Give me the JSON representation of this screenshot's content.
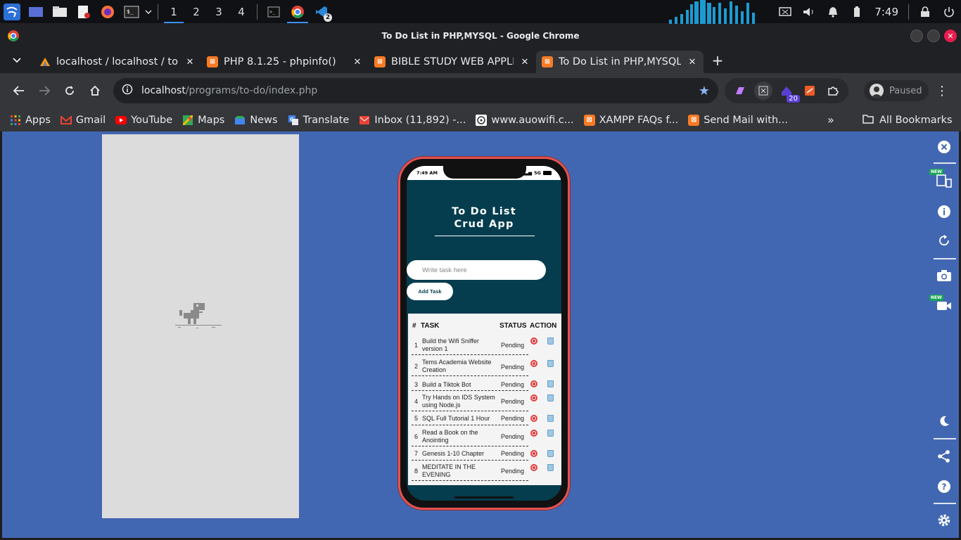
{
  "os_panel": {
    "workspaces": [
      "1",
      "2",
      "3",
      "4"
    ],
    "notifications_badge": "2",
    "clock": "7:49"
  },
  "window": {
    "title": "To Do List in PHP,MYSQL - Google Chrome"
  },
  "tabs": [
    {
      "label": "localhost / localhost / to-do",
      "icon": "phpmyadmin-icon"
    },
    {
      "label": "PHP 8.1.25 - phpinfo()",
      "icon": "xampp-icon"
    },
    {
      "label": "BIBLE STUDY WEB APPLI",
      "icon": "xampp-icon"
    },
    {
      "label": "To Do List in PHP,MYSQL",
      "icon": "xampp-icon",
      "active": true
    }
  ],
  "toolbar": {
    "url_host": "localhost",
    "url_path": "/programs/to-do/index.php",
    "ext_badge": "20",
    "profile_label": "Paused"
  },
  "bookmarks": [
    {
      "label": "Apps"
    },
    {
      "label": "Gmail"
    },
    {
      "label": "YouTube"
    },
    {
      "label": "Maps"
    },
    {
      "label": "News"
    },
    {
      "label": "Translate"
    },
    {
      "label": "Inbox (11,892) -..."
    },
    {
      "label": "www.auowifi.c..."
    },
    {
      "label": "XAMPP FAQs f..."
    },
    {
      "label": "Send Mail with..."
    }
  ],
  "all_bookmarks": "All Bookmarks",
  "phone": {
    "status_time": "7:49 AM",
    "status_signal": "5G",
    "app_title_line1": "To Do List",
    "app_title_line2": "Crud App",
    "input_placeholder": "Write task here",
    "add_button": "Add Task",
    "columns": [
      "#",
      "TASK",
      "STATUS",
      "ACTION"
    ],
    "tasks": [
      {
        "num": "1",
        "task": "Build the Wifi Sniffer version 1",
        "status": "Pending"
      },
      {
        "num": "2",
        "task": "Tems Academia Website Creation",
        "status": "Pending"
      },
      {
        "num": "3",
        "task": "Build a Tiktok Bot",
        "status": "Pending"
      },
      {
        "num": "4",
        "task": "Try Hands on IDS System using Node.js",
        "status": "Pending"
      },
      {
        "num": "5",
        "task": "SQL Full Tutorial 1 Hour",
        "status": "Pending"
      },
      {
        "num": "6",
        "task": "Read a Book on the Anointing",
        "status": "Pending"
      },
      {
        "num": "7",
        "task": "Genesis 1-10 Chapter",
        "status": "Pending"
      },
      {
        "num": "8",
        "task": "MEDITATE IN THE EVENING",
        "status": "Pending"
      }
    ]
  },
  "sidebar": {
    "new_badge": "NEW"
  },
  "colors": {
    "page_bg": "#4267b2",
    "app_bg": "#053d4e",
    "phone_frame": "#e45252"
  }
}
